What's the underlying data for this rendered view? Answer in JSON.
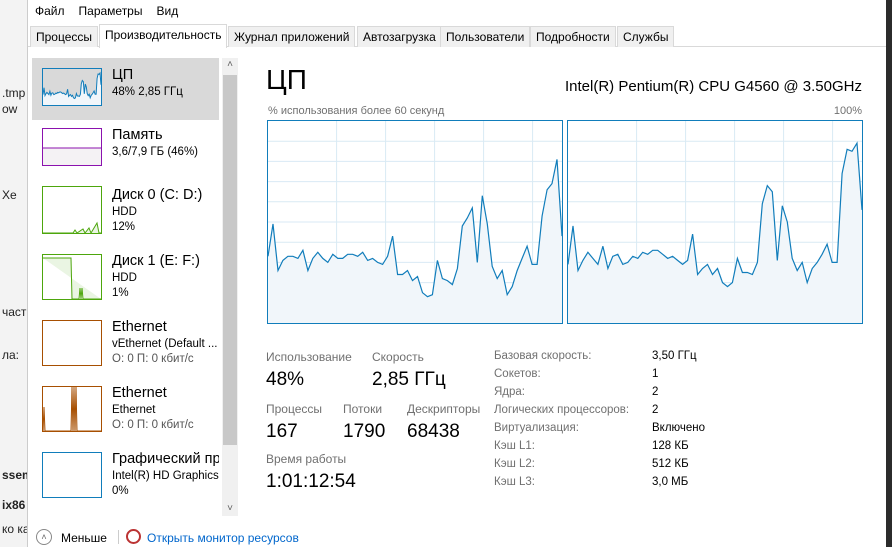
{
  "desktop_fragments": [
    ".tmp",
    "ow",
    "Xe",
    "част",
    "ла:",
    "ssem",
    "ix86",
    "ко ка"
  ],
  "menu": [
    "Файл",
    "Параметры",
    "Вид"
  ],
  "tabs": [
    "Процессы",
    "Производительность",
    "Журнал приложений",
    "Автозагрузка",
    "Пользователи",
    "Подробности",
    "Службы"
  ],
  "sidebar": [
    {
      "title": "ЦП",
      "sub1": "48%  2,85 ГГц",
      "color": "#117dbb"
    },
    {
      "title": "Память",
      "sub1": "3,6/7,9 ГБ (46%)",
      "color": "#8b12ae"
    },
    {
      "title": "Диск 0 (C: D:)",
      "sub1": "HDD",
      "sub2": "12%",
      "color": "#4da60c"
    },
    {
      "title": "Диск 1 (E: F:)",
      "sub1": "HDD",
      "sub2": "1%",
      "color": "#4da60c"
    },
    {
      "title": "Ethernet",
      "sub1": "vEthernet (Default ...",
      "sub2": "О: 0 П: 0 кбит/с",
      "color": "#a74f01"
    },
    {
      "title": "Ethernet",
      "sub1": "Ethernet",
      "sub2": "О: 0 П: 0 кбит/с",
      "color": "#a74f01"
    },
    {
      "title": "Графический пр",
      "sub1": "Intel(R) HD Graphics",
      "sub2": "0%",
      "color": "#117dbb"
    }
  ],
  "main": {
    "title": "ЦП",
    "cpu_name": "Intel(R) Pentium(R) CPU G4560 @ 3.50GHz",
    "caption": "% использования более 60 секунд",
    "max_label": "100%",
    "stats": {
      "usage_label": "Использование",
      "usage": "48%",
      "speed_label": "Скорость",
      "speed": "2,85 ГГц",
      "proc_label": "Процессы",
      "proc": "167",
      "threads_label": "Потоки",
      "threads": "1790",
      "handles_label": "Дескрипторы",
      "handles": "68438",
      "uptime_label": "Время работы",
      "uptime": "1:01:12:54"
    },
    "details": [
      {
        "k": "Базовая скорость:",
        "v": "3,50 ГГц"
      },
      {
        "k": "Сокетов:",
        "v": "1"
      },
      {
        "k": "Ядра:",
        "v": "2"
      },
      {
        "k": "Логических процессоров:",
        "v": "2"
      },
      {
        "k": "Виртуализация:",
        "v": "Включено"
      },
      {
        "k": "Кэш L1:",
        "v": "128 КБ"
      },
      {
        "k": "Кэш L2:",
        "v": "512 КБ"
      },
      {
        "k": "Кэш L3:",
        "v": "3,0 МБ"
      }
    ]
  },
  "chart_data": [
    {
      "type": "area",
      "title": "CPU 0",
      "ylim": [
        0,
        100
      ],
      "xlabel": "60 seconds",
      "values": [
        33,
        49,
        26,
        31,
        33,
        33,
        32,
        36,
        26,
        32,
        35,
        32,
        30,
        34,
        32,
        32,
        34,
        34,
        33,
        35,
        31,
        32,
        30,
        29,
        33,
        43,
        24,
        24,
        26,
        21,
        23,
        15,
        13,
        14,
        31,
        22,
        21,
        19,
        27,
        48,
        52,
        57,
        30,
        63,
        49,
        28,
        22,
        26,
        14,
        18,
        26,
        32,
        38,
        29,
        29,
        53,
        66,
        69,
        81,
        43
      ]
    },
    {
      "type": "area",
      "title": "CPU 1",
      "ylim": [
        0,
        100
      ],
      "xlabel": "60 seconds",
      "values": [
        29,
        48,
        26,
        31,
        35,
        32,
        29,
        38,
        27,
        33,
        34,
        29,
        30,
        33,
        32,
        35,
        34,
        36,
        36,
        34,
        32,
        33,
        31,
        29,
        31,
        44,
        24,
        27,
        29,
        24,
        27,
        20,
        18,
        20,
        32,
        25,
        25,
        24,
        30,
        59,
        68,
        65,
        31,
        58,
        50,
        32,
        26,
        30,
        20,
        27,
        30,
        34,
        39,
        30,
        30,
        74,
        86,
        85,
        89,
        56
      ]
    }
  ],
  "footer": {
    "less": "Меньше",
    "monitor": "Открыть монитор ресурсов"
  }
}
